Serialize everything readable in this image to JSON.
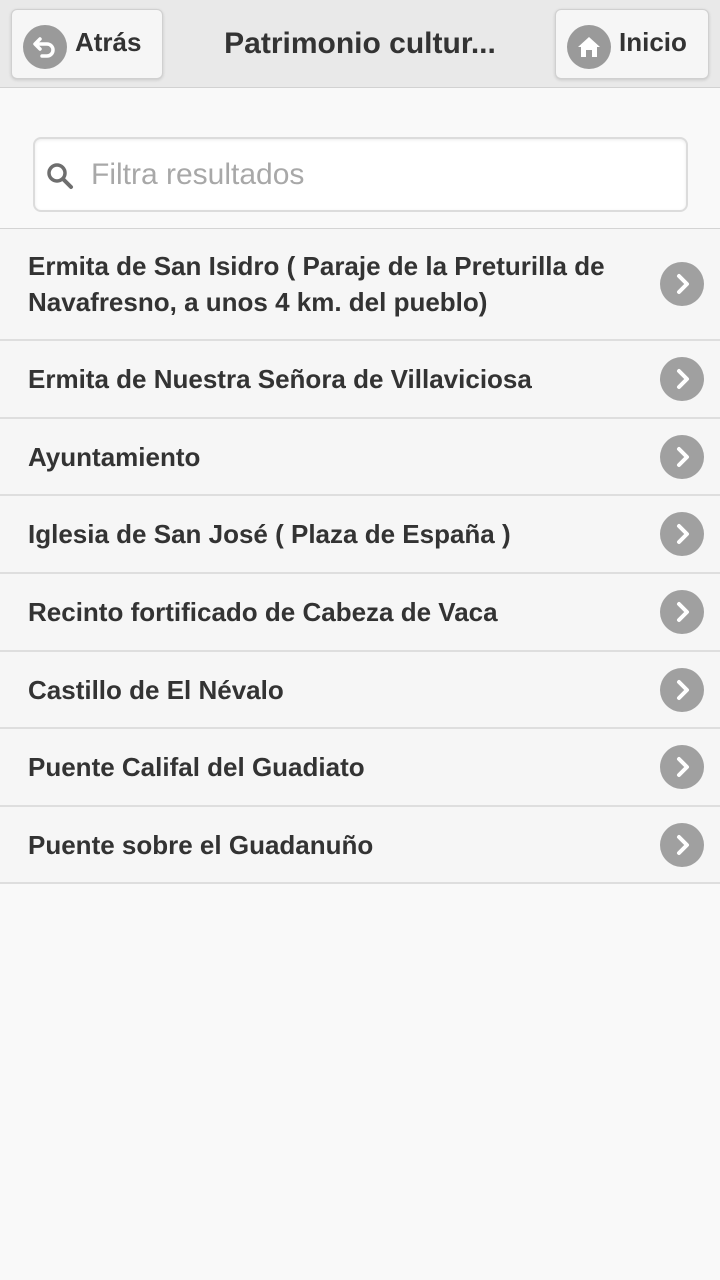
{
  "header": {
    "back_label": "Atrás",
    "title": "Patrimonio cultur...",
    "home_label": "Inicio"
  },
  "search": {
    "placeholder": "Filtra resultados",
    "value": ""
  },
  "list": {
    "items": [
      "Ermita de San Isidro ( Paraje de la Preturilla de Navafresno, a unos 4 km. del pueblo)",
      "Ermita de Nuestra Señora de Villaviciosa",
      "Ayuntamiento",
      "Iglesia de San José ( Plaza de España )",
      "Recinto fortificado de Cabeza de Vaca",
      "Castillo de El Névalo",
      "Puente Califal del Guadiato",
      "Puente sobre el Guadanuño"
    ]
  },
  "icons": {
    "back": "back-arrow-icon",
    "home": "home-icon",
    "search": "search-icon",
    "item": "chevron-right-icon"
  },
  "colors": {
    "header_bg": "#e9e9e9",
    "icon_circle": "#9a9a9a",
    "text": "#333333"
  }
}
